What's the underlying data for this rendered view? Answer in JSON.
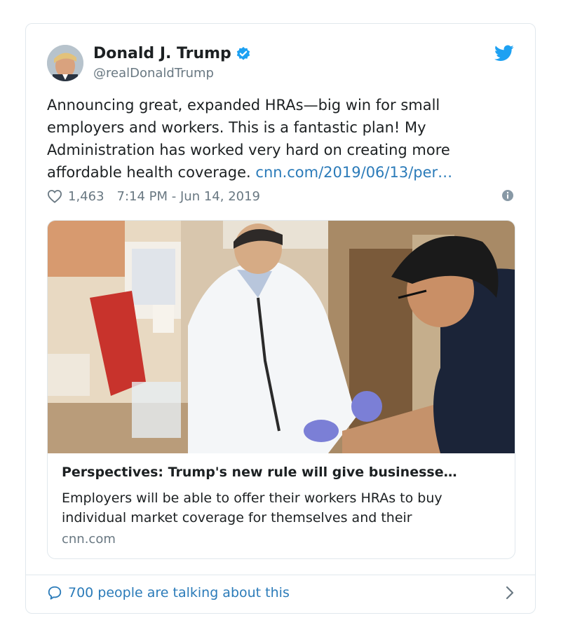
{
  "author": {
    "name": "Donald J. Trump",
    "handle": "@realDonaldTrump",
    "verified_icon": "verified-badge-icon",
    "avatar_icon": "avatar"
  },
  "tweet": {
    "text": "Announcing great, expanded HRAs—big win for small employers and workers. This is a fantastic plan! My Administration has worked very hard on creating more affordable health coverage. ",
    "link_text": "cnn.com/2019/06/13/per…",
    "likes": "1,463",
    "timestamp": "7:14 PM - Jun 14, 2019"
  },
  "card": {
    "title": "Perspectives: Trump's new rule will give businesse…",
    "description": "Employers will be able to offer their workers HRAs to buy individual market coverage for themselves and their",
    "domain": "cnn.com"
  },
  "footer": {
    "talking_text": "700 people are talking about this"
  },
  "colors": {
    "link": "#2b7bb9",
    "secondary_text": "#697882",
    "border": "#e1e8ed",
    "twitter_blue": "#1da1f2"
  }
}
